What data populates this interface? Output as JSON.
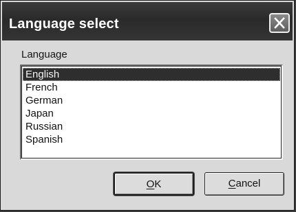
{
  "window": {
    "title": "Language select",
    "close_icon": "close-icon"
  },
  "language_group": {
    "label": "Language",
    "items": [
      {
        "label": "English",
        "selected": true
      },
      {
        "label": "French",
        "selected": false
      },
      {
        "label": "German",
        "selected": false
      },
      {
        "label": "Japan",
        "selected": false
      },
      {
        "label": "Russian",
        "selected": false
      },
      {
        "label": "Spanish",
        "selected": false
      }
    ]
  },
  "buttons": {
    "ok": {
      "mnemonic": "O",
      "rest": "K"
    },
    "cancel": {
      "mnemonic": "C",
      "rest": "ancel"
    }
  }
}
